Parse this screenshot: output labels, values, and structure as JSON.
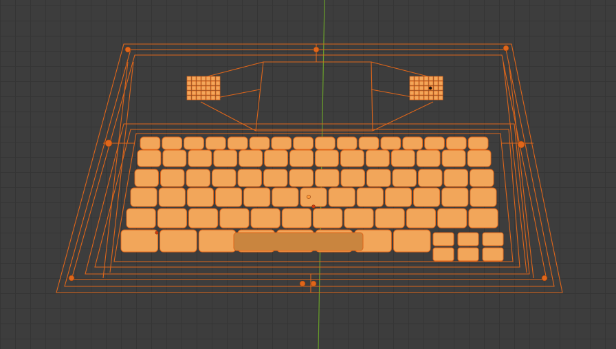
{
  "viewport": {
    "background": "#3d3d3d",
    "grid_color": "#353535",
    "axis_y_color": "#6aa12a",
    "wire_color": "#e0661a",
    "select_color": "#ff8c1a",
    "key_fill": "#f2a65a"
  },
  "object": {
    "name_icon": "laptop-keyboard-wireframe",
    "selected": true
  },
  "keyboard": {
    "row_key_counts": [
      16,
      14,
      14,
      13,
      12,
      8
    ]
  }
}
